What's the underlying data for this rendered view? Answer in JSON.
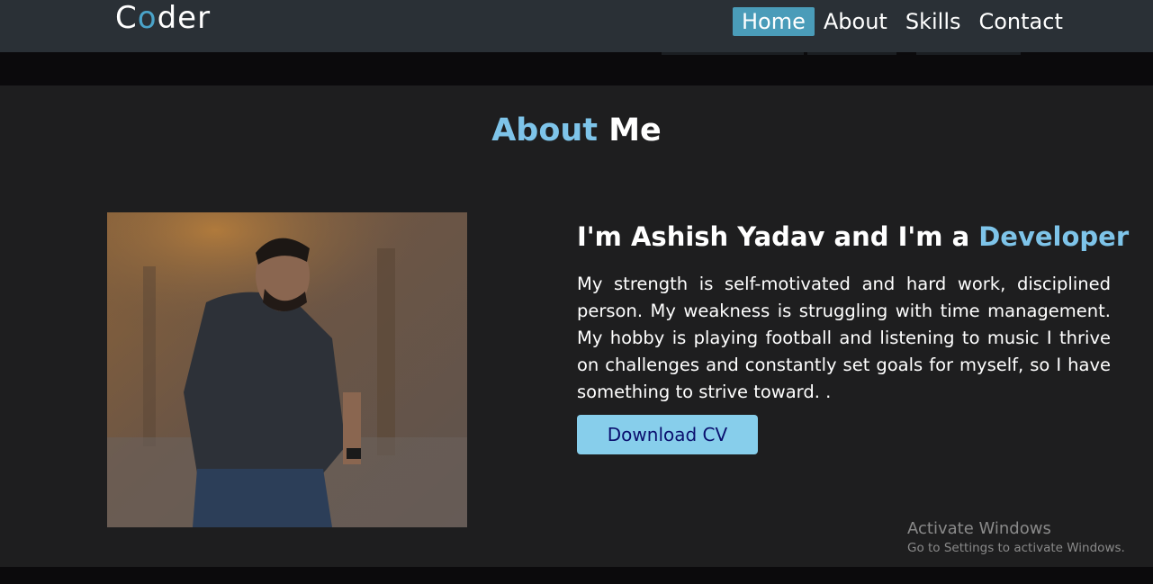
{
  "navbar": {
    "logo": {
      "first": "C",
      "accent": "o",
      "rest": "der"
    },
    "links": [
      {
        "label": "Home",
        "active": true
      },
      {
        "label": "About",
        "active": false
      },
      {
        "label": "Skills",
        "active": false
      },
      {
        "label": "Contact",
        "active": false
      }
    ]
  },
  "about": {
    "title_accent": "About",
    "title_rest": " Me",
    "heading_prefix": "I'm Ashish Yadav and I'm a ",
    "heading_accent": "Developer",
    "bio": "My strength is self-motivated and hard work, disciplined person. My weakness is struggling with time management. My hobby is playing football and listening to music I thrive on challenges and constantly set goals for myself, so I have something to strive toward. .",
    "button_label": "Download CV"
  },
  "watermark": {
    "title": "Activate Windows",
    "subtitle": "Go to Settings to activate Windows."
  },
  "colors": {
    "accent": "#7ec4e9",
    "nav_active": "#4a9cb9",
    "button_bg": "#87ceeb",
    "button_text": "#0a0f6e",
    "section_bg": "#1e1e1f",
    "navbar_bg": "#2a3036"
  }
}
